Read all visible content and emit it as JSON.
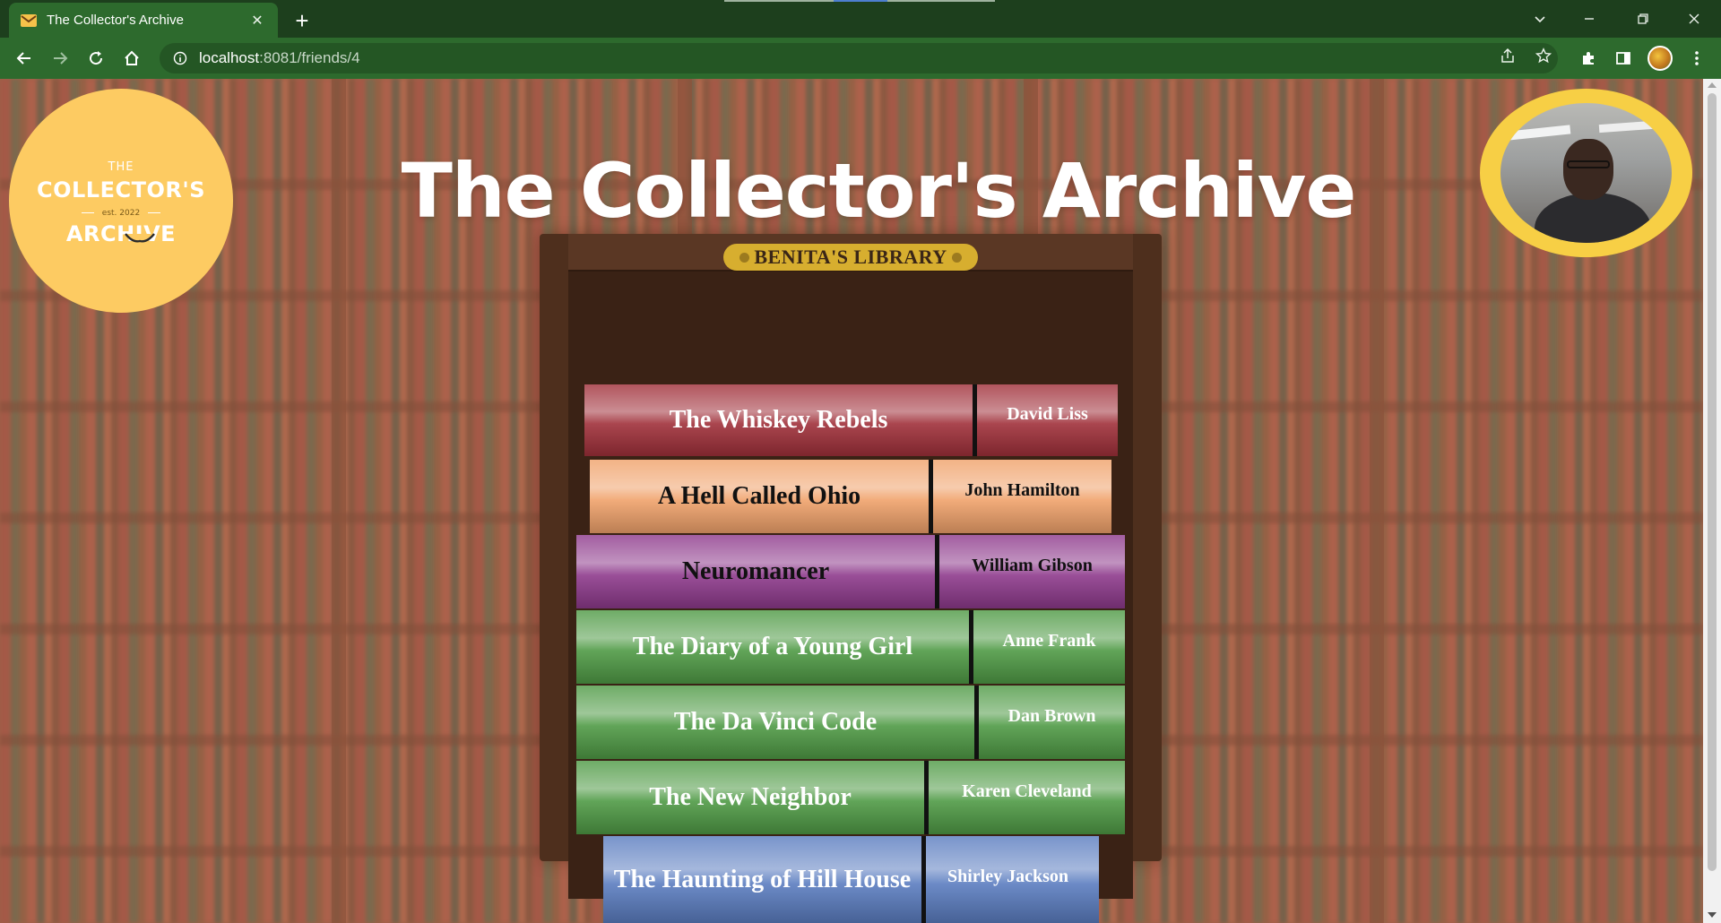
{
  "browser": {
    "tab_title": "The Collector's Archive",
    "tab_close": "✕",
    "new_tab": "+",
    "url_host": "localhost",
    "url_path": ":8081/friends/4"
  },
  "page": {
    "title": "The Collector's Archive",
    "logo": {
      "the": "THE",
      "collectors": "COLLECTOR'S",
      "est": "est. 2022",
      "archive": "ARCHIVE"
    },
    "library_label": "BENITA'S LIBRARY",
    "books": [
      {
        "title": "The Whiskey Rebels",
        "author": "David Liss",
        "color": "#a0303a",
        "text_color": "#ffffff"
      },
      {
        "title": "A Hell Called Ohio",
        "author": "John Hamilton",
        "color": "#f0a26b",
        "text_color": "#111111"
      },
      {
        "title": "Neuromancer",
        "author": "William Gibson",
        "color": "#8e3a8c",
        "text_color": "#111111"
      },
      {
        "title": "The Diary of a Young Girl",
        "author": "Anne Frank",
        "color": "#4f9a45",
        "text_color": "#ffffff"
      },
      {
        "title": "The Da Vinci Code",
        "author": "Dan Brown",
        "color": "#4f9a45",
        "text_color": "#ffffff"
      },
      {
        "title": "The New Neighbor",
        "author": "Karen Cleveland",
        "color": "#4f9a45",
        "text_color": "#ffffff"
      },
      {
        "title": "The Haunting of Hill House",
        "author": "Shirley Jackson",
        "color": "#5b7dc0",
        "text_color": "#ffffff"
      }
    ]
  },
  "colors": {
    "chrome_dark": "#1d3f1d",
    "chrome": "#2d6a2d",
    "logo_yellow": "#fdcb62",
    "avatar_ring": "#f7cf45",
    "plaque_gold": "#d7ae2f"
  }
}
